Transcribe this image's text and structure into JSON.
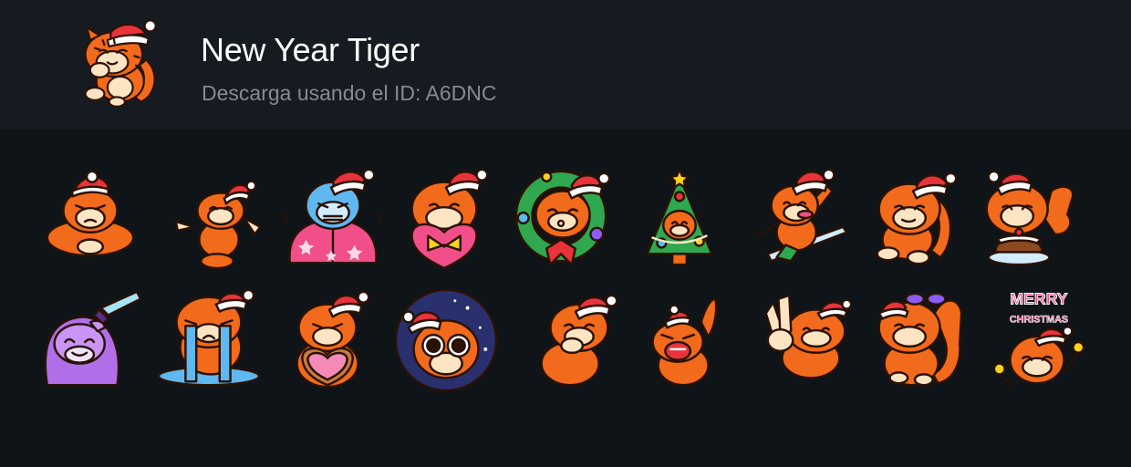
{
  "header": {
    "title": "New Year Tiger",
    "subtitle": "Descarga usando el ID: A6DNC"
  },
  "colors": {
    "background": "#0f1419",
    "header_background": "#161b21",
    "tiger_orange": "#f26a1b",
    "tiger_light": "#fde4c2",
    "santa_hat_red": "#e8333b"
  },
  "stickers": [
    {
      "name": "sticker-angry-arms-crossed",
      "icon": "tiger-angry"
    },
    {
      "name": "sticker-dancing",
      "icon": "tiger-dance"
    },
    {
      "name": "sticker-freezing-blanket",
      "icon": "tiger-cold"
    },
    {
      "name": "sticker-heart-gift",
      "icon": "tiger-gift"
    },
    {
      "name": "sticker-wreath-kiss",
      "icon": "tiger-wreath"
    },
    {
      "name": "sticker-christmas-tree",
      "icon": "tiger-tree"
    },
    {
      "name": "sticker-skiing",
      "icon": "tiger-ski"
    },
    {
      "name": "sticker-smug",
      "icon": "tiger-smug"
    },
    {
      "name": "sticker-pudding-thumbs-up",
      "icon": "tiger-pudding"
    },
    {
      "name": "sticker-knife-ghost",
      "icon": "tiger-knife"
    },
    {
      "name": "sticker-crying-river",
      "icon": "tiger-crying"
    },
    {
      "name": "sticker-heart-cookie",
      "icon": "tiger-cookie"
    },
    {
      "name": "sticker-big-eyes-space",
      "icon": "tiger-bigeyes"
    },
    {
      "name": "sticker-thinking",
      "icon": "tiger-thinking"
    },
    {
      "name": "sticker-angry-scream",
      "icon": "tiger-scream"
    },
    {
      "name": "sticker-peace-sign",
      "icon": "tiger-peace"
    },
    {
      "name": "sticker-party-glasses",
      "icon": "tiger-party"
    },
    {
      "name": "sticker-merry-christmas",
      "icon": "tiger-merry",
      "text": "MERRY CHRISTMAS"
    }
  ]
}
